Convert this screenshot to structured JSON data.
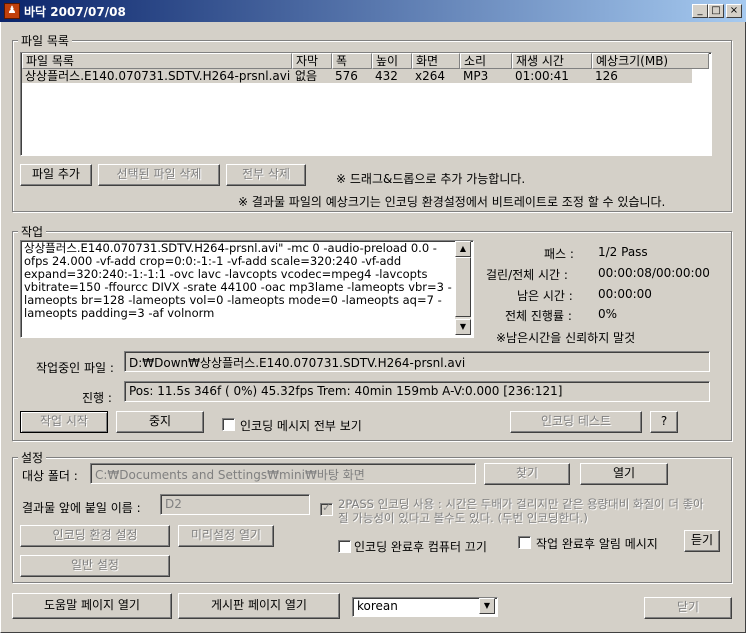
{
  "window": {
    "title": "바닥 2007/07/08",
    "controls": [
      "_",
      "□",
      "×"
    ]
  },
  "file_list": {
    "group_label": "파일 목록",
    "columns": [
      "파일 목록",
      "자막",
      "폭",
      "높이",
      "화면",
      "소리",
      "재생 시간",
      "예상크기(MB)"
    ],
    "rows": [
      [
        "상상플러스.E140.070731.SDTV.H264-prsnl.avi",
        "없음",
        "576",
        "432",
        "x264",
        "MP3",
        "01:00:41",
        "126"
      ]
    ],
    "add_button": "파일 추가",
    "delete_selected_button": "선택된 파일 삭제",
    "delete_all_button": "전부 삭제",
    "drag_hint": "※ 드래그&드롭으로 추가 가능합니다.",
    "size_hint": "※ 결과물 파일의 예상크기는 인코딩 환경설정에서 비트레이트로 조정 할 수 있습니다."
  },
  "job": {
    "group_label": "작업",
    "command_lines": [
      "상상플러스.E140.070731.SDTV.H264-prsnl.avi\" -mc 0 -audio-preload 0.0 -",
      "ofps 24.000 -vf-add crop=0:0:-1:-1  -vf-add scale=320:240 -vf-add",
      "expand=320:240:-1:-1:1 -ovc lavc -lavcopts vcodec=mpeg4   -lavcopts",
      "vbitrate=150  -ffourcc DIVX -srate 44100 -oac mp3lame -lameopts vbr=3  -",
      "lameopts br=128 -lameopts vol=0 -lameopts mode=0 -lameopts aq=7 -",
      "lameopts padding=3 -af volnorm"
    ],
    "pass_label": "패스 :",
    "pass_value": "1/2 Pass",
    "elapsed_label": "걸린/전체 시간 :",
    "elapsed_value": "00:00:08/00:00:00",
    "remaining_label": "남은 시간 :",
    "remaining_value": "00:00:00",
    "progress_label": "전체 진행률 :",
    "progress_value": "0%",
    "remaining_note": "※남은시간을 신뢰하지 말것",
    "current_file_label": "작업중인 파일 :",
    "current_file_value": "D:₩Down₩상상플러스.E140.070731.SDTV.H264-prsnl.avi",
    "status_label": "진행 :",
    "status_value": "Pos:  11.5s    346f ( 0%)  45.32fps Trem:  40min 159mb  A-V:0.000 [236:121]",
    "start_button": "작업 시작",
    "stop_button": "중지",
    "show_all_messages": "인코딩 메시지 전부 보기",
    "encoding_test_button": "인코딩 테스트",
    "help_button": "?"
  },
  "settings": {
    "group_label": "설정",
    "target_folder_label": "대상 폴더 :",
    "target_folder_value": "C:₩Documents and Settings₩mini₩바탕 화면",
    "browse_button": "찾기",
    "open_button": "열기",
    "prefix_label": "결과물 앞에 붙일 이름 :",
    "prefix_value": "D2",
    "twopass_text": "2PASS 인코딩 사용 : 시간은 두배가 걸리지만 같은 용량대비 화질이 더 좋아질 가능성이 있다고 볼수도 있다. (두번 인코딩한다.)",
    "encoding_settings_button": "인코딩 환경 설정",
    "preset_button": "미리설정 열기",
    "shutdown_checkbox": "인코딩 완료후 컴퓨터 끄기",
    "notify_checkbox": "작업 완료후 알림 메시지",
    "listen_button": "듣기",
    "general_settings_button": "일반 설정"
  },
  "bottom": {
    "help_page_button": "도움말 페이지 열기",
    "board_page_button": "게시판 페이지 열기",
    "language_value": "korean",
    "close_button": "닫기"
  }
}
